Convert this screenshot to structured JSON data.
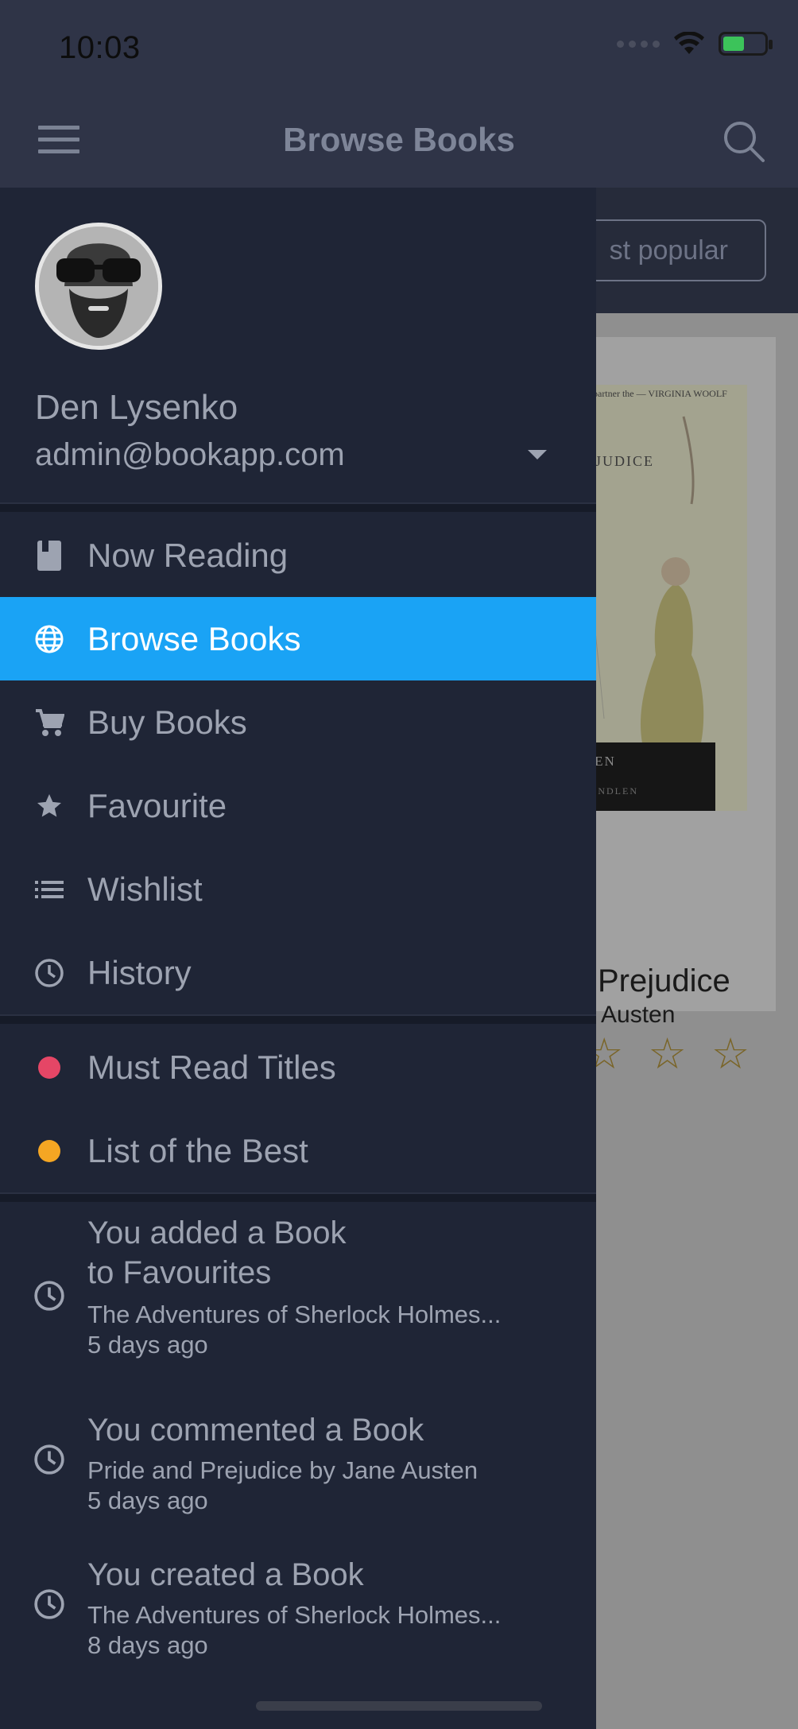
{
  "status_bar": {
    "time": "10:03"
  },
  "header": {
    "title": "Browse Books",
    "menu_icon": "hamburger-icon",
    "search_icon": "search-icon"
  },
  "background": {
    "filter_label": "Most popular",
    "filter_visible_text": "st popular",
    "book": {
      "title_visible": "Prejudice",
      "author_visible": "Austen",
      "stars": "☆ ☆ ☆",
      "cover_text_top": "has for partner the — VIRGINIA WOOLF",
      "cover_title": "PREJUDICE",
      "cover_author": "USTEN",
      "cover_intro": "A QUINDLEN"
    }
  },
  "drawer": {
    "user": {
      "name": "Den Lysenko",
      "email": "admin@bookapp.com"
    },
    "nav_items": [
      {
        "label": "Now Reading",
        "icon": "book-icon",
        "active": false
      },
      {
        "label": "Browse Books",
        "icon": "globe-icon",
        "active": true
      },
      {
        "label": "Buy Books",
        "icon": "cart-icon",
        "active": false
      },
      {
        "label": "Favourite",
        "icon": "star-icon",
        "active": false
      },
      {
        "label": "Wishlist",
        "icon": "list-icon",
        "active": false
      },
      {
        "label": "History",
        "icon": "clock-icon",
        "active": false
      }
    ],
    "lists": [
      {
        "label": "Must Read Titles",
        "color": "#e54666"
      },
      {
        "label": "List of the Best",
        "color": "#f5a623"
      }
    ],
    "activity": [
      {
        "title": "You added a Book\nto Favourites",
        "subtitle": "The Adventures of Sherlock Holmes...",
        "time": "5 days ago"
      },
      {
        "title": "You commented a Book",
        "subtitle": "Pride and Prejudice by Jane Austen",
        "time": "5 days ago"
      },
      {
        "title": "You created a Book",
        "subtitle": "The Adventures of Sherlock Holmes...",
        "time": "8 days ago"
      }
    ]
  },
  "colors": {
    "accent": "#1aa3f5",
    "drawer_bg": "#1f2536",
    "text_muted": "#9da3b1"
  }
}
